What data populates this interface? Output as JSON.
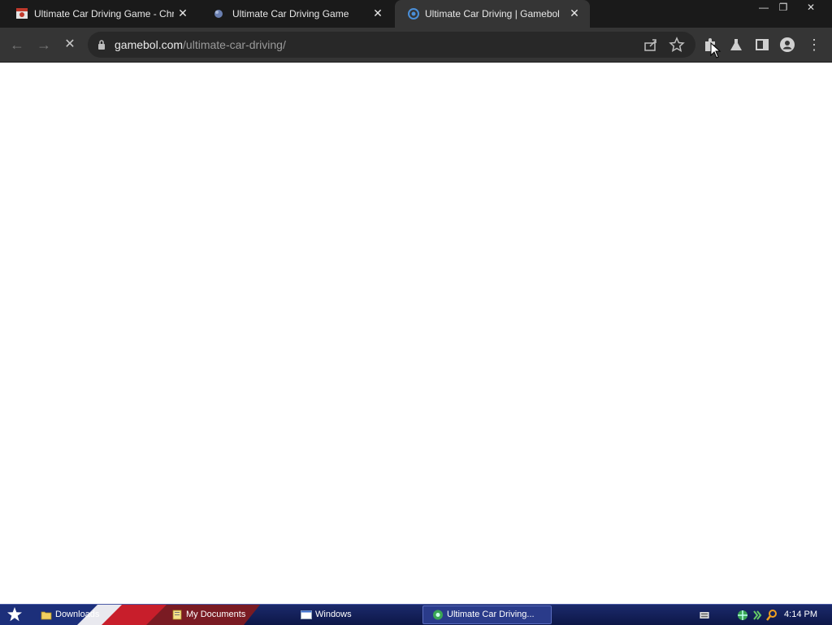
{
  "browser": {
    "tabs": [
      {
        "title": "Ultimate Car Driving Game - Chrome Web Store",
        "active": false,
        "favicon": "chrome-web-store-icon"
      },
      {
        "title": "Ultimate Car Driving Game",
        "active": false,
        "favicon": "globe-icon"
      },
      {
        "title": "Ultimate Car Driving | Gamebol",
        "active": true,
        "favicon": "gamebol-icon"
      }
    ],
    "close_glyph": "✕",
    "window_controls": {
      "minimize": "—",
      "restore": "❐",
      "close": "✕"
    },
    "toolbar": {
      "back_glyph": "←",
      "forward_glyph": "→",
      "stop_glyph": "✕",
      "url_host": "gamebol.com",
      "url_path": "/ultimate-car-driving/",
      "menu_glyph": "⋮"
    }
  },
  "taskbar": {
    "items": [
      {
        "label": "Downloads",
        "icon": "folder-icon"
      },
      {
        "label": "My Documents",
        "icon": "documents-icon"
      },
      {
        "label": "Windows",
        "icon": "window-icon"
      },
      {
        "label": "Ultimate Car Driving...",
        "icon": "browser-icon"
      }
    ],
    "clock": "4:14 PM"
  },
  "colors": {
    "tabstrip_bg": "#1a1a1a",
    "toolbar_bg": "#353535",
    "omnibox_bg": "#282828",
    "taskbar_bg": "#0d1748"
  }
}
